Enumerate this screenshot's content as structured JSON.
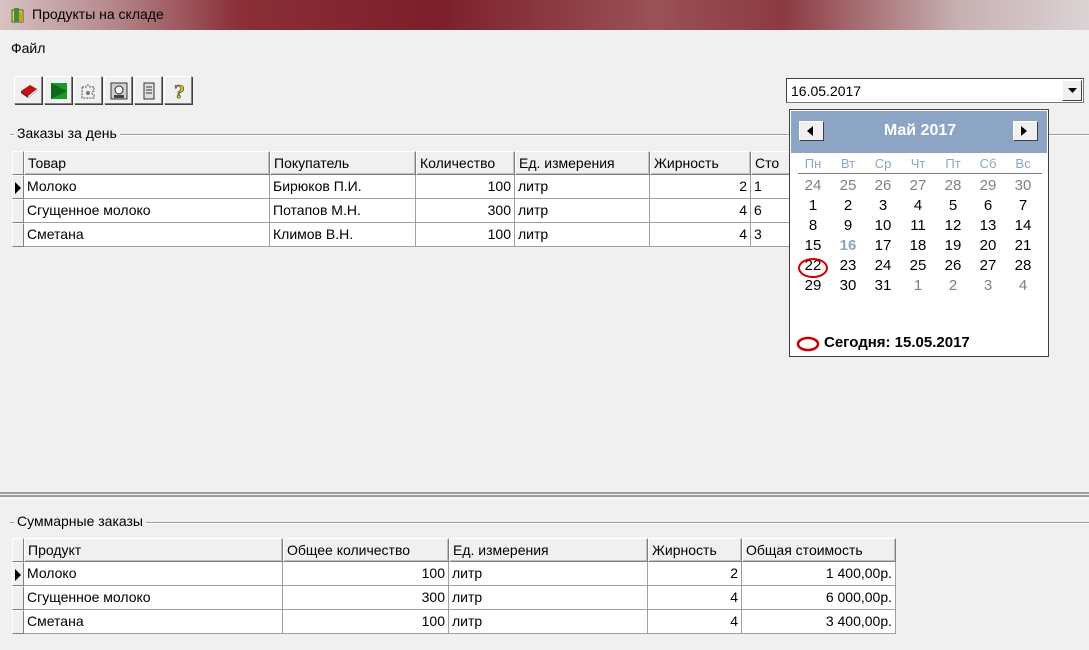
{
  "window": {
    "title": "Продукты на складе"
  },
  "menu": {
    "file": "Файл"
  },
  "toolbar": {
    "buttons": [
      "book-icon",
      "green-flag-icon",
      "puzzle-icon",
      "portrait-icon",
      "document-icon",
      "help-icon"
    ]
  },
  "date_picker": {
    "value": "16.05.2017"
  },
  "orders_day": {
    "label": "Заказы за день",
    "columns": [
      "Товар",
      "Покупатель",
      "Количество",
      "Ед. измерения",
      "Жирность",
      "Сто"
    ],
    "rows": [
      {
        "product": "Молоко",
        "buyer": "Бирюков П.И.",
        "qty": "100",
        "unit": "литр",
        "fat": "2",
        "cost": "1"
      },
      {
        "product": "Сгущенное молоко",
        "buyer": "Потапов М.Н.",
        "qty": "300",
        "unit": "литр",
        "fat": "4",
        "cost": "6"
      },
      {
        "product": "Сметана",
        "buyer": "Климов В.Н.",
        "qty": "100",
        "unit": "литр",
        "fat": "4",
        "cost": "3"
      }
    ]
  },
  "calendar": {
    "month": "Май 2017",
    "weekdays": [
      "Пн",
      "Вт",
      "Ср",
      "Чт",
      "Пт",
      "Сб",
      "Вс"
    ],
    "weeks": [
      [
        "24",
        "25",
        "26",
        "27",
        "28",
        "29",
        "30"
      ],
      [
        "1",
        "2",
        "3",
        "4",
        "5",
        "6",
        "7"
      ],
      [
        "8",
        "9",
        "10",
        "11",
        "12",
        "13",
        "14"
      ],
      [
        "15",
        "16",
        "17",
        "18",
        "19",
        "20",
        "21"
      ],
      [
        "22",
        "23",
        "24",
        "25",
        "26",
        "27",
        "28"
      ],
      [
        "29",
        "30",
        "31",
        "1",
        "2",
        "3",
        "4"
      ]
    ],
    "today_text": "Сегодня: 15.05.2017",
    "selected_day": "16",
    "today_day": "15",
    "accent_color": "#8ca5c5",
    "today_color": "#d00000"
  },
  "summary": {
    "label": "Суммарные заказы",
    "columns": [
      "Продукт",
      "Общее количество",
      "Ед. измерения",
      "Жирность",
      "Общая стоимость"
    ],
    "rows": [
      {
        "product": "Молоко",
        "qty": "100",
        "unit": "литр",
        "fat": "2",
        "total": "1 400,00р."
      },
      {
        "product": "Сгущенное молоко",
        "qty": "300",
        "unit": "литр",
        "fat": "4",
        "total": "6 000,00р."
      },
      {
        "product": "Сметана",
        "qty": "100",
        "unit": "литр",
        "fat": "4",
        "total": "3 400,00р."
      }
    ]
  }
}
